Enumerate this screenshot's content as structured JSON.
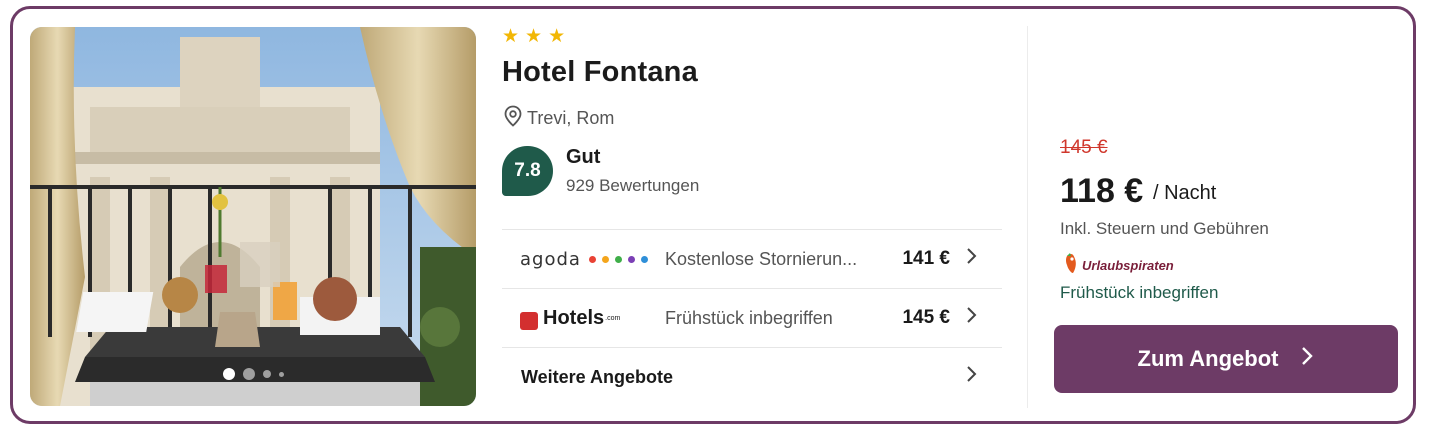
{
  "hotel": {
    "stars": 3,
    "name": "Hotel Fontana",
    "location": "Trevi, Rom",
    "rating": {
      "score": "7.8",
      "label": "Gut",
      "reviews": "929 Bewertungen"
    }
  },
  "gallery": {
    "image_count": 4,
    "active_index": 0
  },
  "offers": [
    {
      "provider": "agoda",
      "description": "Kostenlose Stornierun...",
      "price": "141 €"
    },
    {
      "provider": "Hotels",
      "provider_suffix": ".com",
      "description": "Frühstück inbegriffen",
      "price": "145 €"
    }
  ],
  "more_offers_label": "Weitere Angebote",
  "price_panel": {
    "old_price": "145 €",
    "price": "118 €",
    "per_night": "/ Nacht",
    "tax_note": "Inkl. Steuern und Gebühren",
    "partner": "Urlaubspiraten",
    "breakfast": "Frühstück inbegriffen",
    "cta_label": "Zum Angebot"
  },
  "colors": {
    "accent": "#6d3b66",
    "rating_badge": "#1f5a4a",
    "old_price": "#d0372c",
    "star": "#f2b705",
    "agoda_dots": [
      "#e94235",
      "#f4a51c",
      "#3fae49",
      "#7b3fb5",
      "#2f8fd8"
    ]
  },
  "icons": {
    "location": "map-pin-icon",
    "chevron": "chevron-right-icon",
    "star": "star-icon"
  }
}
